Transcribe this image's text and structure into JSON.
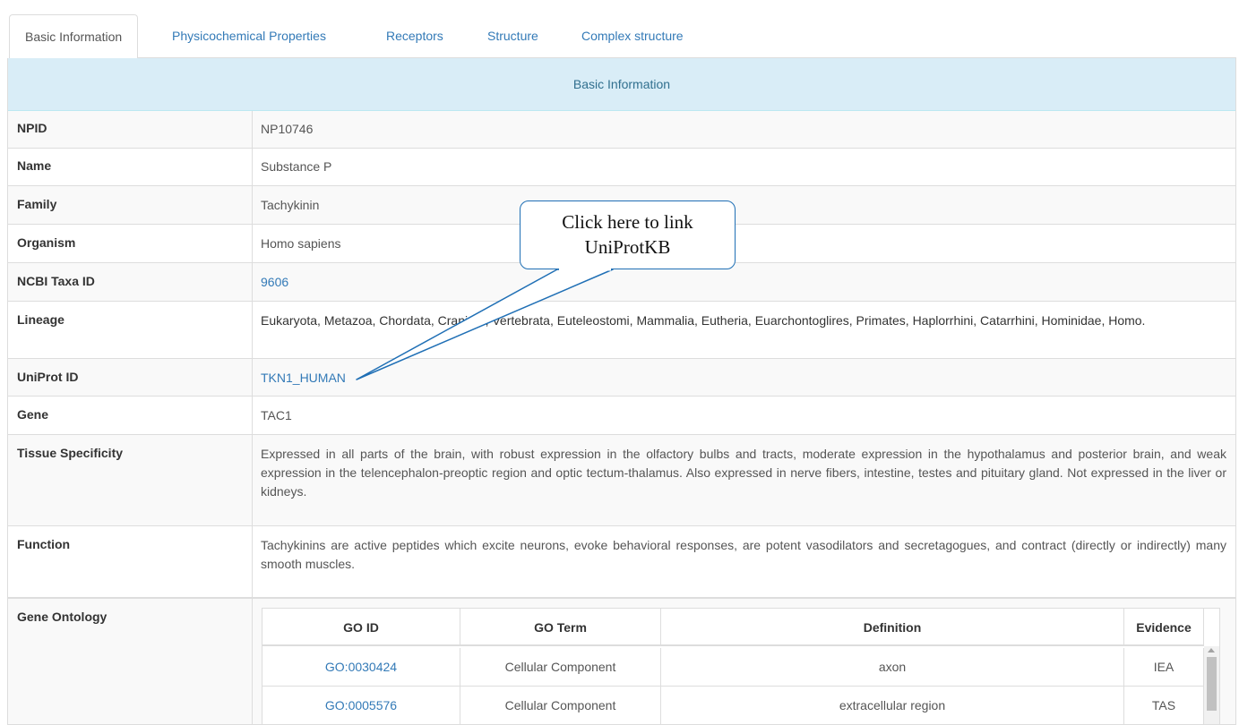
{
  "tabs": [
    {
      "label": "Basic Information",
      "active": true
    },
    {
      "label": "Physicochemical Properties",
      "active": false
    },
    {
      "label": "Receptors",
      "active": false
    },
    {
      "label": "Structure",
      "active": false
    },
    {
      "label": "Complex structure",
      "active": false
    }
  ],
  "panel": {
    "heading": "Basic Information",
    "rows": {
      "npid": {
        "label": "NPID",
        "value": "NP10746"
      },
      "name": {
        "label": "Name",
        "value": "Substance P"
      },
      "family": {
        "label": "Family",
        "value": "Tachykinin"
      },
      "organism": {
        "label": "Organism",
        "value": "Homo sapiens"
      },
      "taxa": {
        "label": "NCBI Taxa ID",
        "value": "9606"
      },
      "lineage": {
        "label": "Lineage",
        "value": "Eukaryota, Metazoa, Chordata, Craniata, Vertebrata, Euteleostomi, Mammalia, Eutheria, Euarchontoglires, Primates, Haplorrhini, Catarrhini, Hominidae, Homo."
      },
      "uniprot": {
        "label": "UniProt ID",
        "value": "TKN1_HUMAN"
      },
      "gene": {
        "label": "Gene",
        "value": "TAC1"
      },
      "tissue": {
        "label": "Tissue Specificity",
        "value": "Expressed in all parts of the brain, with robust expression in the olfactory bulbs and tracts, moderate expression in the hypothalamus and posterior brain, and weak expression in the telencephalon-preoptic region and optic tectum-thalamus. Also expressed in nerve fibers, intestine, testes and pituitary gland. Not expressed in the liver or kidneys."
      },
      "function": {
        "label": "Function",
        "value": "Tachykinins are active peptides which excite neurons, evoke behavioral responses, are potent vasodilators and secretagogues, and contract (directly or indirectly) many smooth muscles."
      },
      "ontology": {
        "label": "Gene Ontology"
      }
    }
  },
  "go_table": {
    "headers": [
      "GO ID",
      "GO Term",
      "Definition",
      "Evidence"
    ],
    "rows": [
      {
        "go_id": "GO:0030424",
        "term": "Cellular Component",
        "definition": "axon",
        "evidence": "IEA"
      },
      {
        "go_id": "GO:0005576",
        "term": "Cellular Component",
        "definition": "extracellular region",
        "evidence": "TAS"
      }
    ]
  },
  "callout": {
    "line1": "Click here to link",
    "line2": "UniProtKB"
  },
  "colors": {
    "link": "#337ab7",
    "heading_bg": "#d9edf7",
    "heading_text": "#31708f",
    "callout_border": "#1f6fb5"
  }
}
